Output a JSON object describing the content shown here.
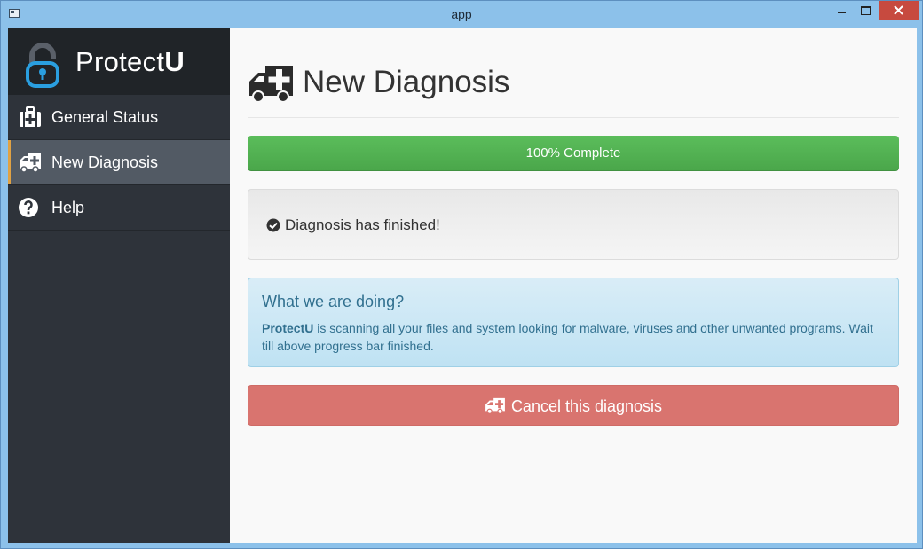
{
  "window": {
    "title": "app"
  },
  "brand": {
    "name_regular": "Protect",
    "name_bold": "U"
  },
  "sidebar": {
    "items": [
      {
        "label": "General Status",
        "icon": "medkit-icon",
        "active": false
      },
      {
        "label": "New Diagnosis",
        "icon": "ambulance-icon",
        "active": true
      },
      {
        "label": "Help",
        "icon": "question-circle-icon",
        "active": false
      }
    ]
  },
  "main": {
    "title": "New Diagnosis",
    "progress": {
      "label": "100% Complete",
      "value": 100
    },
    "status": {
      "text": "Diagnosis has finished!",
      "icon": "check-circle-icon"
    },
    "info": {
      "title": "What we are doing?",
      "app_name": "ProtectU",
      "body": " is scanning all your files and system looking for malware, viruses and other unwanted programs. Wait till above progress bar finished."
    },
    "cancel_button": {
      "label": "Cancel this diagnosis",
      "icon": "ambulance-icon"
    }
  },
  "colors": {
    "sidebar_bg": "#2e333a",
    "active_accent": "#e0a244",
    "progress": "#5cb85c",
    "danger": "#d9746f",
    "info_text": "#31708f"
  }
}
